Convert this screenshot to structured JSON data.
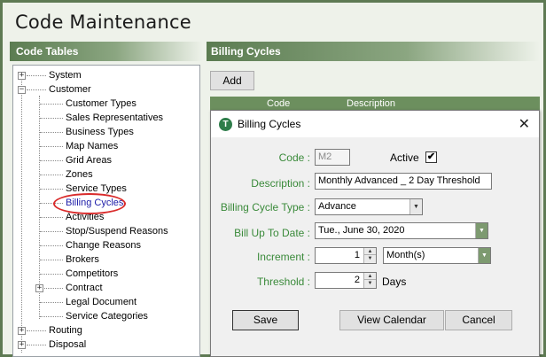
{
  "app": {
    "title": "Code Maintenance"
  },
  "left_panel": {
    "header": "Code Tables"
  },
  "tree": {
    "system": "System",
    "customer": "Customer",
    "customer_children": [
      "Customer Types",
      "Sales Representatives",
      "Business Types",
      "Map Names",
      "Grid Areas",
      "Zones",
      "Service Types",
      "Billing Cycles",
      "Activities",
      "Stop/Suspend Reasons",
      "Change Reasons",
      "Brokers",
      "Competitors",
      "Contract",
      "Legal Document",
      "Service Categories"
    ],
    "routing": "Routing",
    "disposal": "Disposal",
    "selected": "Billing Cycles"
  },
  "right_panel": {
    "header": "Billing Cycles",
    "add_label": "Add",
    "columns": [
      "Code",
      "Description"
    ]
  },
  "dialog": {
    "title": "Billing Cycles",
    "icon_letter": "T",
    "code_label": "Code :",
    "code_value": "M2",
    "active_label": "Active",
    "active_checked": "✔",
    "description_label": "Description :",
    "description_value": "Monthly Advanced _ 2 Day Threshold",
    "billing_cycle_type_label": "Billing Cycle Type :",
    "billing_cycle_type_value": "Advance",
    "bill_up_to_date_label": "Bill Up To Date :",
    "bill_up_to_date_value": "Tue., June 30, 2020",
    "increment_label": "Increment :",
    "increment_value": "1",
    "increment_unit_value": "Month(s)",
    "threshold_label": "Threshold :",
    "threshold_value": "2",
    "threshold_unit": "Days",
    "buttons": {
      "save": "Save",
      "view_calendar": "View Calendar",
      "cancel": "Cancel"
    }
  },
  "colors": {
    "accent_green": "#5b7c51",
    "label_green": "#3a8a3a",
    "highlight_red": "#d92b2b"
  }
}
